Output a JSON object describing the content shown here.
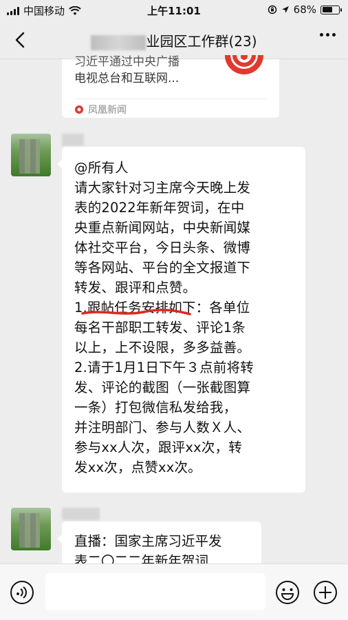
{
  "status_bar": {
    "carrier": "中国移动",
    "time": "上午11:01",
    "battery": "68%",
    "battery_level": 0.68
  },
  "header": {
    "title_suffix": "业园区工作群(23)"
  },
  "link_card": {
    "text_line1": "习近平通过中央广播",
    "text_line2": "电视总台和互联网...",
    "source": "凤凰新闻"
  },
  "message1": {
    "text": "@所有人\n请大家针对习主席今天晚上发\n表的2022年新年贺词，在中\n央重点新闻网站，中央新闻媒\n体社交平台，今日头条、微博\n等各网站、平台的全文报道下\n转发、跟评和点赞。\n1.跟帖任务安排如下：各单位\n每名干部职工转发、评论1条\n以上，上不设限，多多益善。\n2.请于1月1日下午３点前将转\n发、评论的截图（一张截图算\n一条）打包微信私发给我，\n并注明部门、参与人数Ｘ人、\n参与xx人次，跟评xx次，转\n发xx次，点赞xx次。"
  },
  "message2": {
    "text": "直播：国家主席习近平发\n表二〇二二年新年贺词"
  },
  "colors": {
    "background": "#ededed",
    "bubble": "#ffffff",
    "underline": "#e0271f",
    "logo_red": "#e3382e"
  }
}
